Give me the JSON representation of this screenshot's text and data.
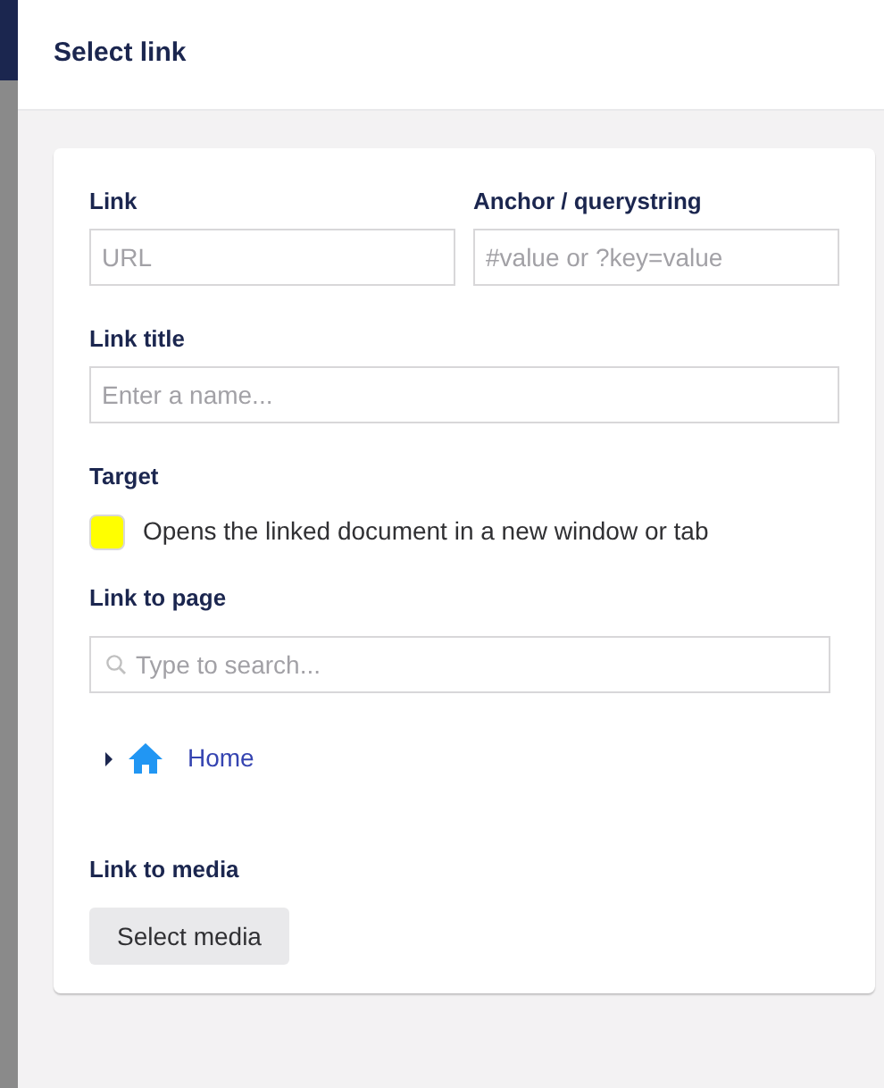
{
  "dialog": {
    "title": "Select link"
  },
  "link": {
    "label": "Link",
    "placeholder": "URL"
  },
  "anchor": {
    "label": "Anchor / querystring",
    "placeholder": "#value or ?key=value"
  },
  "link_title": {
    "label": "Link title",
    "placeholder": "Enter a name..."
  },
  "target": {
    "label": "Target",
    "on": false,
    "description": "Opens the linked document in a new window or tab"
  },
  "link_to_page": {
    "label": "Link to page",
    "search": {
      "placeholder": "Type to search..."
    },
    "tree": [
      {
        "label": "Home",
        "expanded": false
      }
    ]
  },
  "link_to_media": {
    "label": "Link to media",
    "button": "Select media"
  }
}
